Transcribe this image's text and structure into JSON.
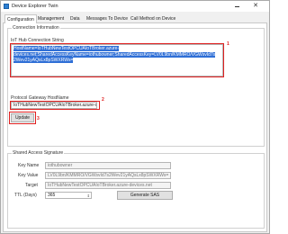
{
  "window": {
    "title": "Device Explorer Twin"
  },
  "tabs": [
    {
      "label": "Configuration"
    },
    {
      "label": "Management"
    },
    {
      "label": "Data"
    },
    {
      "label": "Messages To Device"
    },
    {
      "label": "Call Method on Device"
    }
  ],
  "connection": {
    "group_label": "Connection Information",
    "hub_label": "IoT Hub Connection String",
    "connection_string_line1": "HostName=IoTHubNewTestOPCUAIoTBroker.azure-",
    "connection_string_line2": "devices.net;SharedAccessKeyName=iothubowner;SharedAccessKey=LV0L9bn/KMMRO/VGWsvId7s",
    "connection_string_line3": "2Wev21yAQsLx8pSWXRWs=",
    "gateway_label": "Protocol Gateway HostName",
    "gateway_value": "IoTHubNewTestOPCUAIoTBroker.azure-devices.net",
    "update_button": "Update"
  },
  "sas": {
    "group_label": "Shared Access Signature",
    "key_name_label": "Key Name",
    "key_name_value": "iothubowner",
    "key_value_label": "Key Value",
    "key_value_value": "LV0L9bn/KMMRO/VGWsvId7s2Wev21yAQsLx8pSWXRWs=",
    "target_label": "Target",
    "target_value": "IoTHubNewTestOPCUAIoTBroker.azure-devices.net",
    "ttl_label": "TTL (Days)",
    "ttl_value": "365",
    "generate_button": "Generate SAS"
  },
  "annotations": {
    "mark1": "1",
    "mark2": "2",
    "mark3": "3"
  },
  "colors": {
    "highlight": "#2f6fd6",
    "annotation": "#e02020"
  }
}
